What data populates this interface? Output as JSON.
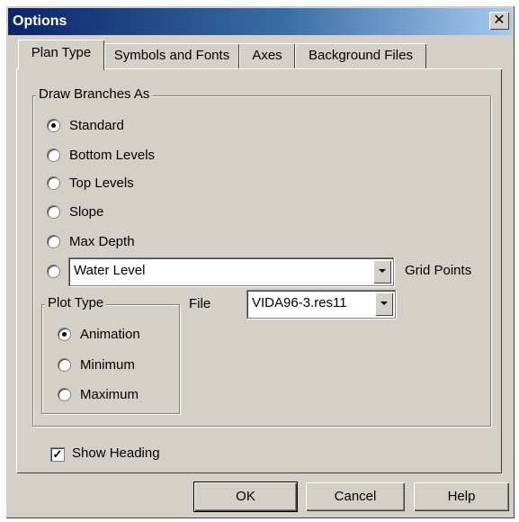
{
  "window": {
    "title": "Options",
    "close_glyph": "✕"
  },
  "tabs": [
    {
      "label": "Plan Type",
      "active": true
    },
    {
      "label": "Symbols and Fonts",
      "active": false
    },
    {
      "label": "Axes",
      "active": false
    },
    {
      "label": "Background Files",
      "active": false
    }
  ],
  "draw_branches": {
    "group_label": "Draw Branches As",
    "options": [
      {
        "label": "Standard",
        "checked": true
      },
      {
        "label": "Bottom Levels",
        "checked": false
      },
      {
        "label": "Top Levels",
        "checked": false
      },
      {
        "label": "Slope",
        "checked": false
      },
      {
        "label": "Max Depth",
        "checked": false
      }
    ],
    "custom_option_checked": false,
    "variable_value": "Water Level",
    "grid_points_label": "Grid Points"
  },
  "plot_type": {
    "group_label": "Plot Type",
    "options": [
      {
        "label": "Animation",
        "checked": true
      },
      {
        "label": "Minimum",
        "checked": false
      },
      {
        "label": "Maximum",
        "checked": false
      }
    ]
  },
  "file": {
    "label": "File",
    "value": "VIDA96-3.res11"
  },
  "show_heading": {
    "label": "Show Heading",
    "checked": true,
    "check_glyph": "✓"
  },
  "buttons": {
    "ok": "OK",
    "cancel": "Cancel",
    "help": "Help"
  }
}
